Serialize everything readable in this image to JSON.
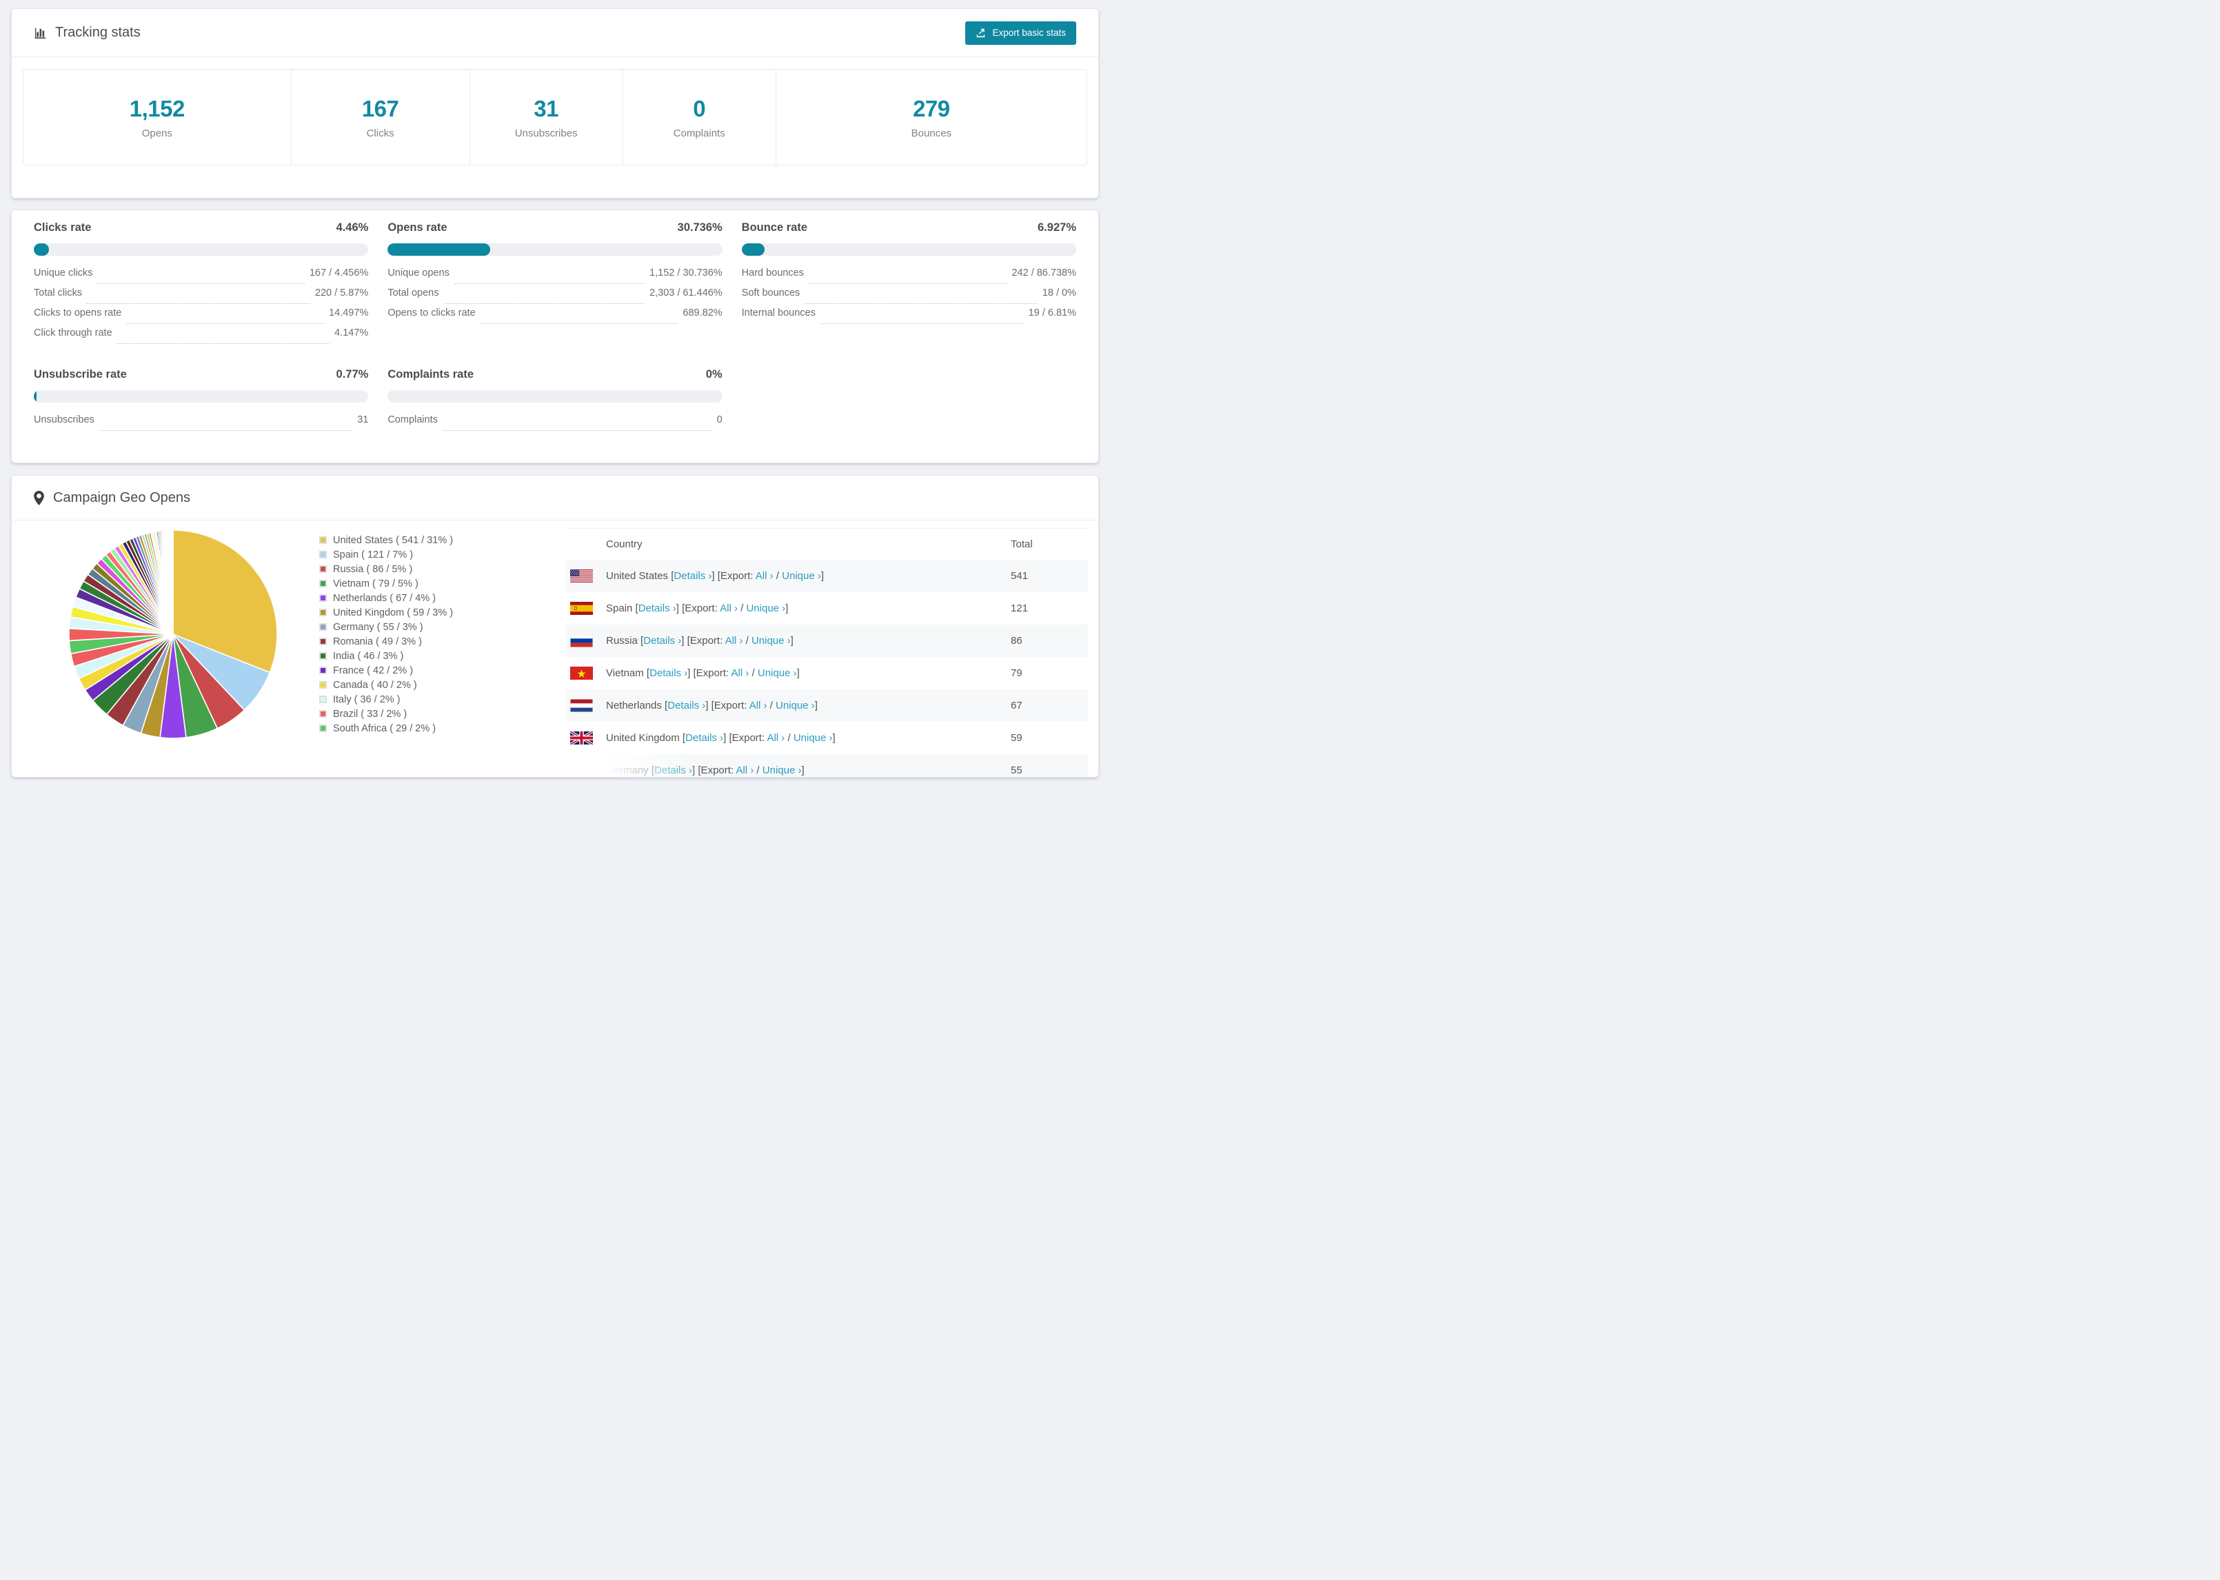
{
  "colors": {
    "accent": "#0e87a1",
    "link": "#2b9dbf",
    "stat_number": "#1289a4"
  },
  "tracking": {
    "title": "Tracking stats",
    "export_label": "Export basic stats",
    "stats": [
      {
        "value": "1,152",
        "label": "Opens"
      },
      {
        "value": "167",
        "label": "Clicks"
      },
      {
        "value": "31",
        "label": "Unsubscribes"
      },
      {
        "value": "0",
        "label": "Complaints"
      },
      {
        "value": "279",
        "label": "Bounces"
      }
    ]
  },
  "rates": [
    {
      "title": "Clicks rate",
      "value": "4.46%",
      "pct": 4.46,
      "rows": [
        {
          "label": "Unique clicks",
          "value": "167 / 4.456%"
        },
        {
          "label": "Total clicks",
          "value": "220 / 5.87%"
        },
        {
          "label": "Clicks to opens rate",
          "value": "14.497%"
        },
        {
          "label": "Click through rate",
          "value": "4.147%"
        }
      ]
    },
    {
      "title": "Opens rate",
      "value": "30.736%",
      "pct": 30.736,
      "rows": [
        {
          "label": "Unique opens",
          "value": "1,152 / 30.736%"
        },
        {
          "label": "Total opens",
          "value": "2,303 / 61.446%"
        },
        {
          "label": "Opens to clicks rate",
          "value": "689.82%"
        }
      ]
    },
    {
      "title": "Bounce rate",
      "value": "6.927%",
      "pct": 6.927,
      "rows": [
        {
          "label": "Hard bounces",
          "value": "242 / 86.738%"
        },
        {
          "label": "Soft bounces",
          "value": "18 / 0%"
        },
        {
          "label": "Internal bounces",
          "value": "19 / 6.81%"
        }
      ]
    },
    {
      "title": "Unsubscribe rate",
      "value": "0.77%",
      "pct": 0.77,
      "rows": [
        {
          "label": "Unsubscribes",
          "value": "31"
        }
      ]
    },
    {
      "title": "Complaints rate",
      "value": "0%",
      "pct": 0,
      "rows": [
        {
          "label": "Complaints",
          "value": "0"
        }
      ]
    }
  ],
  "geo": {
    "title": "Campaign Geo Opens",
    "legend": [
      "United States ( 541 / 31% )",
      "Spain ( 121 / 7% )",
      "Russia ( 86 / 5% )",
      "Vietnam ( 79 / 5% )",
      "Netherlands ( 67 / 4% )",
      "United Kingdom ( 59 / 3% )",
      "Germany ( 55 / 3% )",
      "Romania ( 49 / 3% )",
      "India ( 46 / 3% )",
      "France ( 42 / 2% )",
      "Canada ( 40 / 2% )",
      "Italy ( 36 / 2% )",
      "Brazil ( 33 / 2% )",
      "South Africa ( 29 / 2% )"
    ],
    "table": {
      "headers": [
        "Country",
        "Total"
      ],
      "link_text": {
        "details": "Details ›",
        "export": "Export:",
        "all": "All ›",
        "unique": "Unique ›",
        "open_bracket": "[",
        "close_bracket": "]",
        "separator": "/"
      },
      "rows": [
        {
          "country": "United States",
          "flag": "us",
          "total": "541"
        },
        {
          "country": "Spain",
          "flag": "es",
          "total": "121"
        },
        {
          "country": "Russia",
          "flag": "ru",
          "total": "86"
        },
        {
          "country": "Vietnam",
          "flag": "vn",
          "total": "79"
        },
        {
          "country": "Netherlands",
          "flag": "nl",
          "total": "67"
        },
        {
          "country": "United Kingdom",
          "flag": "gb",
          "total": "59"
        },
        {
          "country": "Germany",
          "flag": "de",
          "total": "55"
        }
      ]
    },
    "chart_data": {
      "type": "pie",
      "title": "Campaign Geo Opens",
      "legend_position": "right",
      "start_angle_deg": 0,
      "direction": "clockwise",
      "slices": [
        {
          "label": "United States",
          "value": 541,
          "pct": 31,
          "color": "#e9c244"
        },
        {
          "label": "Spain",
          "value": 121,
          "pct": 7,
          "color": "#a9d3f2"
        },
        {
          "label": "Russia",
          "value": 86,
          "pct": 5,
          "color": "#cb4a4c"
        },
        {
          "label": "Vietnam",
          "value": 79,
          "pct": 5,
          "color": "#45a24b"
        },
        {
          "label": "Netherlands",
          "value": 67,
          "pct": 4,
          "color": "#8f42ea"
        },
        {
          "label": "United Kingdom",
          "value": 59,
          "pct": 3,
          "color": "#b6952f"
        },
        {
          "label": "Germany",
          "value": 55,
          "pct": 3,
          "color": "#87a6c0"
        },
        {
          "label": "Romania",
          "value": 49,
          "pct": 3,
          "color": "#9a393b"
        },
        {
          "label": "India",
          "value": 46,
          "pct": 3,
          "color": "#2f7d33"
        },
        {
          "label": "France",
          "value": 42,
          "pct": 2,
          "color": "#6c2bc2"
        },
        {
          "label": "Canada",
          "value": 40,
          "pct": 2,
          "color": "#f3d83c"
        },
        {
          "label": "Italy",
          "value": 36,
          "pct": 2,
          "color": "#d6f6f8"
        },
        {
          "label": "Brazil",
          "value": 33,
          "pct": 2,
          "color": "#ee5c5d"
        },
        {
          "label": "South Africa",
          "value": 29,
          "pct": 2,
          "color": "#57c763"
        }
      ],
      "others": {
        "note": "long tail of unlabeled small country slices",
        "total_pct": 26,
        "count": 46,
        "decay": 0.93,
        "palette": [
          "#ef5e5e",
          "#d8f7f9",
          "#f4ef3d",
          "#eef8ff",
          "#5b2d9e",
          "#2f7d32",
          "#8a3038",
          "#5a7d96",
          "#8a7a1e",
          "#d94fe0",
          "#58d96a",
          "#fa6e6e",
          "#9cf0a8",
          "#e070f0",
          "#f7dc3a",
          "#2a2a6e",
          "#7e1f2a",
          "#1e5c2a",
          "#7b3fe4",
          "#6b8ba4",
          "#b6952f",
          "#a8d4f5",
          "#c7a23a",
          "#65e871"
        ]
      }
    }
  }
}
